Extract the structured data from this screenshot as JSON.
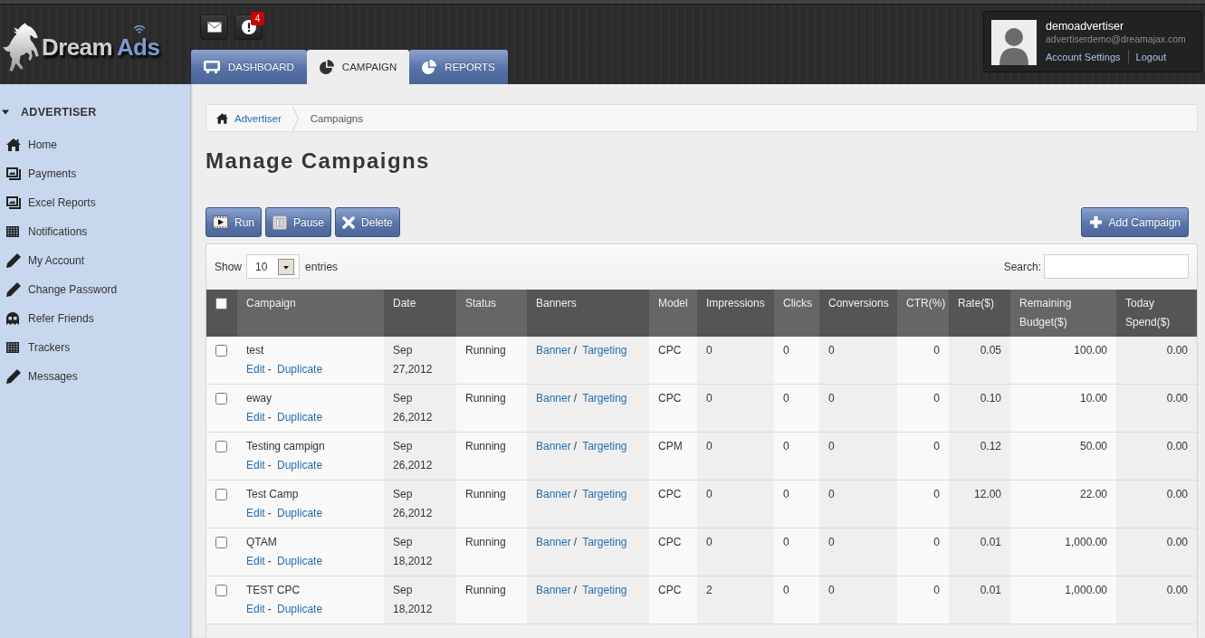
{
  "top_bar": {
    "logo": {
      "word_1": "Dream",
      "word_2": "Ads"
    },
    "notifications_badge": "4",
    "nav_tabs": [
      {
        "label": "DASHBOARD",
        "selected": false
      },
      {
        "label": "CAMPAIGN",
        "selected": true
      },
      {
        "label": "REPORTS",
        "selected": false
      }
    ],
    "user": {
      "name": "demoadvertiser",
      "email": "advertiserdemo@dreamajax.com",
      "links": [
        "Account Settings",
        "Logout"
      ]
    }
  },
  "sidebar": {
    "heading": "ADVERTISER",
    "expanded": true,
    "items": [
      {
        "label": "Home",
        "selected": false
      },
      {
        "label": "Payments",
        "selected": false
      },
      {
        "label": "Excel Reports",
        "selected": false
      },
      {
        "label": "Notifications",
        "selected": false
      },
      {
        "label": "My Account",
        "selected": false
      },
      {
        "label": "Change Password",
        "selected": false
      },
      {
        "label": "Refer Friends",
        "selected": false
      },
      {
        "label": "Trackers",
        "selected": false
      },
      {
        "label": "Messages",
        "selected": false
      }
    ]
  },
  "breadcrumb": [
    {
      "label": "Advertiser",
      "kind": "link"
    },
    {
      "label": "Campaigns",
      "kind": "current"
    }
  ],
  "page_title": "Manage Campaigns",
  "actions": [
    {
      "label": "Run"
    },
    {
      "label": "Pause"
    },
    {
      "label": "Delete"
    }
  ],
  "add_button": "Add Campaign",
  "table_controls": {
    "show_label": "Show",
    "page_size": "10",
    "entries_label": "entries",
    "search_label": "Search:"
  },
  "table": {
    "select_all_checked": false,
    "columns": [
      "Campaign",
      "Date",
      "Status",
      "Banners",
      "Model",
      "Impressions",
      "Clicks",
      "Conversions",
      "CTR(%)",
      "Rate($)",
      "Remaining Budget($)",
      "Today Spend($)"
    ],
    "rows": [
      {
        "checked": false,
        "campaign": "test",
        "links": {
          "items": [
            "Edit",
            "Duplicate"
          ],
          "separator": "-"
        },
        "date": "Sep 27,2012",
        "status": "Running",
        "banners": {
          "items": [
            "Banner",
            "Targeting"
          ],
          "separator": "/"
        },
        "model": "CPC",
        "impressions": "0",
        "clicks": "0",
        "conversions": "0",
        "ctr": "0",
        "rate": "0.05",
        "remaining_budget": "100.00",
        "today_spend": "0.00"
      },
      {
        "checked": false,
        "campaign": "eway",
        "links": {
          "items": [
            "Edit",
            "Duplicate"
          ],
          "separator": "-"
        },
        "date": "Sep 26,2012",
        "status": "Running",
        "banners": {
          "items": [
            "Banner",
            "Targeting"
          ],
          "separator": "/"
        },
        "model": "CPC",
        "impressions": "0",
        "clicks": "0",
        "conversions": "0",
        "ctr": "0",
        "rate": "0.10",
        "remaining_budget": "10.00",
        "today_spend": "0.00"
      },
      {
        "checked": false,
        "campaign": "Testing campign",
        "links": {
          "items": [
            "Edit",
            "Duplicate"
          ],
          "separator": "-"
        },
        "date": "Sep 26,2012",
        "status": "Running",
        "banners": {
          "items": [
            "Banner",
            "Targeting"
          ],
          "separator": "/"
        },
        "model": "CPM",
        "impressions": "0",
        "clicks": "0",
        "conversions": "0",
        "ctr": "0",
        "rate": "0.12",
        "remaining_budget": "50.00",
        "today_spend": "0.00"
      },
      {
        "checked": false,
        "campaign": "Test Camp",
        "links": {
          "items": [
            "Edit",
            "Duplicate"
          ],
          "separator": "-"
        },
        "date": "Sep 26,2012",
        "status": "Running",
        "banners": {
          "items": [
            "Banner",
            "Targeting"
          ],
          "separator": "/"
        },
        "model": "CPC",
        "impressions": "0",
        "clicks": "0",
        "conversions": "0",
        "ctr": "0",
        "rate": "12.00",
        "remaining_budget": "22.00",
        "today_spend": "0.00"
      },
      {
        "checked": false,
        "campaign": "QTAM",
        "links": {
          "items": [
            "Edit",
            "Duplicate"
          ],
          "separator": "-"
        },
        "date": "Sep 18,2012",
        "status": "Running",
        "banners": {
          "items": [
            "Banner",
            "Targeting"
          ],
          "separator": "/"
        },
        "model": "CPC",
        "impressions": "0",
        "clicks": "0",
        "conversions": "0",
        "ctr": "0",
        "rate": "0.01",
        "remaining_budget": "1,000.00",
        "today_spend": "0.00"
      },
      {
        "checked": false,
        "campaign": "TEST CPC",
        "links": {
          "items": [
            "Edit",
            "Duplicate"
          ],
          "separator": "-"
        },
        "date": "Sep 18,2012",
        "status": "Running",
        "banners": {
          "items": [
            "Banner",
            "Targeting"
          ],
          "separator": "/"
        },
        "model": "CPC",
        "impressions": "2",
        "clicks": "0",
        "conversions": "0",
        "ctr": "0",
        "rate": "0.01",
        "remaining_budget": "1,000.00",
        "today_spend": "0.00"
      }
    ]
  }
}
